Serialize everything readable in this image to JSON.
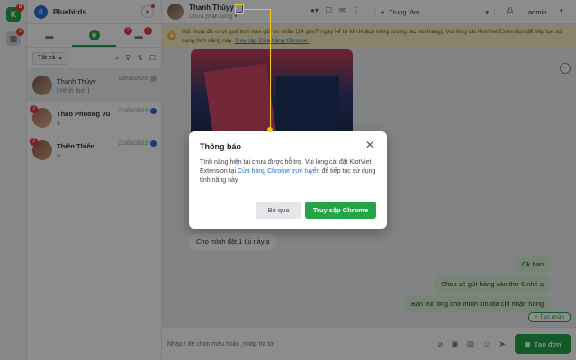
{
  "rail": {
    "app_icon": "brand-app-icon",
    "app_badge": "8",
    "calendar_icon": "calendar-icon",
    "calendar_badge": "3"
  },
  "page": {
    "name": "Bluebirds",
    "avatar_letter": "B",
    "chevron": "▾"
  },
  "tabs": [
    {
      "icon": "comments-icon",
      "glyph": "▬",
      "badge": "",
      "active": false
    },
    {
      "icon": "messenger-icon",
      "glyph": "◉",
      "badge": "2",
      "active": true
    },
    {
      "icon": "comment-alert-icon",
      "glyph": "▬",
      "badge": "1",
      "active": false
    }
  ],
  "filter": {
    "select_label": "Tất cả",
    "caret": "▾",
    "icons": [
      "search-icon",
      "filter-icon",
      "sort-icon",
      "checkbox-icon"
    ],
    "glyphs": [
      "⌕",
      "⊽",
      "⇅",
      "☐"
    ]
  },
  "conversations": [
    {
      "name": "Thanh Thủyy",
      "message": "[ Hình ảnh ]",
      "date": "23/06/2023",
      "badge": "",
      "avatar_color": "#7b5a4a",
      "status_color": "#b8bcc2",
      "unread": false
    },
    {
      "name": "Thao Phuong Vu",
      "message": "a",
      "date": "31/05/2023",
      "badge": "3",
      "avatar_color": "#a86a55",
      "status_color": "#2a6fdb",
      "unread": true
    },
    {
      "name": "Thiên Thiên",
      "message": "a",
      "date": "31/05/2023",
      "badge": "3",
      "avatar_color": "#8e5b4d",
      "status_color": "#2a6fdb",
      "unread": true
    }
  ],
  "chat_header": {
    "name": "Thanh Thủyy",
    "subtitle": "Chưa phân công",
    "subtitle_caret": "▾",
    "tools": [
      "status-dot-icon",
      "square-icon",
      "mail-icon",
      "more-vertical-icon"
    ],
    "tool_glyphs": [
      "●▾",
      "☐",
      "✉",
      "⋮"
    ],
    "branch_icon": "location-icon",
    "branch": "Trung tâm",
    "branch_caret": "▾",
    "printer_glyph": "⎙",
    "user": "admin",
    "user_caret": "▾"
  },
  "warning": {
    "icon": "warning-icon",
    "glyph": "▲",
    "text": "Hội thoại đã vượt quá thời hạn gửi tin nhắn (24 giờ/7 ngày kể từ khi khách hàng tương tác với trang). Vui lòng cài KiotViet Extension để tiếp tục sử dụng tính năng này.",
    "link": "Truy cập Cửa hàng Chrome."
  },
  "messages": {
    "incoming": "Cho mình đặt 1 túi này ạ",
    "outgoing": [
      "Ok bạn",
      "Shop sẽ gửi hàng vào thứ 6 nhé ạ",
      "Bạn vui lòng cho mình xin địa chỉ nhận hàng"
    ]
  },
  "tag_button": "+ Tạo nhãn",
  "composer": {
    "placeholder": "Nhập / để chọn mẫu hoặc, nhấp trả lời",
    "icons": [
      "attach-icon",
      "image-icon",
      "file-icon",
      "emoji-icon",
      "send-icon"
    ],
    "glyphs": [
      "⌀",
      "▣",
      "▤",
      "☺",
      "➤"
    ],
    "create_label": "Tạo đơn",
    "create_icon": "cart-icon",
    "create_glyph": "🛒"
  },
  "modal": {
    "title": "Thông báo",
    "close": "✕",
    "body_before": "Tính năng hiện tại chưa được hỗ trợ. Vui lòng cài đặt KiotViet Extension tại ",
    "body_link": "Cửa hàng Chrome trực tuyến",
    "body_after": " để tiếp tục sử dụng tính năng này.",
    "skip_label": "Bỏ qua",
    "visit_label": "Truy cập Chrome"
  },
  "colors": {
    "brand_green": "#22a447",
    "warning_bg": "#fbeec4",
    "link_blue": "#1e6fd9",
    "pointer_yellow": "#f5c518"
  }
}
